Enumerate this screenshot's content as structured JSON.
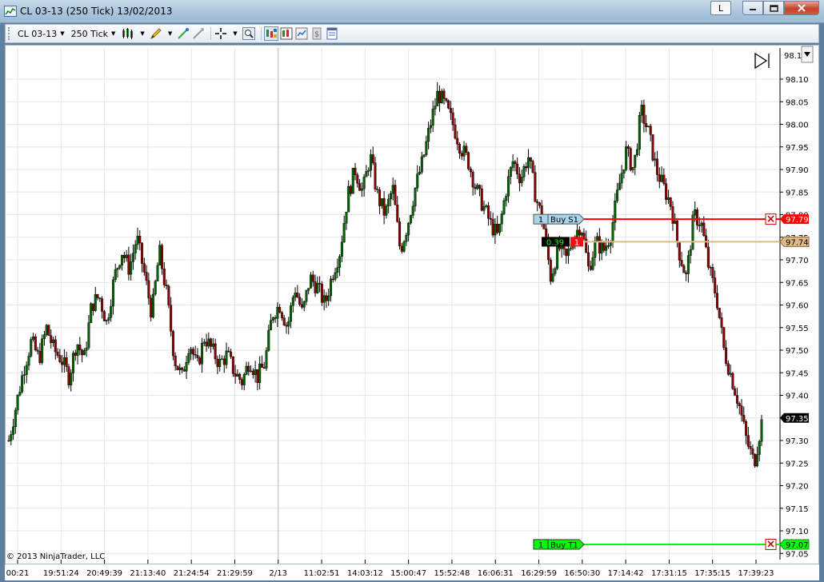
{
  "window": {
    "title": "CL 03-13 (250 Tick)  13/02/2013",
    "buttons": {
      "link_label": "L",
      "minimize": "minimize",
      "maximize": "maximize",
      "close": "close"
    }
  },
  "toolbar": {
    "instrument": "CL 03-13",
    "interval": "250 Tick",
    "icons": [
      "bar-type-icon",
      "drawing-pencil-icon",
      "draw-objects-icon",
      "drawing-remove-icon",
      "crosshair-icon",
      "zoom-icon",
      "chart-trader-icon",
      "data-box-icon",
      "strategies-icon",
      "dollar-icon",
      "properties-icon"
    ]
  },
  "chart": {
    "copyright": "© 2013 NinjaTrader, LLC",
    "y_ticks": [
      "98.10",
      "98.05",
      "98.00",
      "97.95",
      "97.90",
      "97.85",
      "97.80",
      "97.75",
      "97.70",
      "97.65",
      "97.60",
      "97.55",
      "97.50",
      "97.45",
      "97.40",
      "97.35",
      "97.30",
      "97.25",
      "97.20",
      "97.15",
      "97.10",
      "97.05"
    ],
    "y_top_partial": "98.1",
    "x_ticks": [
      "00:21",
      "19:51:24",
      "20:49:39",
      "21:13:40",
      "21:24:54",
      "21:29:59",
      "2/13",
      "11:02:51",
      "14:03:12",
      "15:00:47",
      "15:52:48",
      "16:06:31",
      "16:29:59",
      "16:50:30",
      "17:14:42",
      "17:31:15",
      "17:35:15",
      "17:39:23"
    ],
    "last_price": "97.35",
    "orders": {
      "stop": {
        "qty": "1",
        "label": "Buy S1",
        "price": "97.79",
        "color": "#ff0000"
      },
      "target": {
        "qty": "1",
        "label": "Buy T1",
        "price": "97.07",
        "color": "#00ff00"
      }
    },
    "position": {
      "pnl": "0.39",
      "qty": "1",
      "price": "97.74",
      "color": "#deb887"
    },
    "colors": {
      "up_candle": "#006400",
      "down_candle": "#8b0000",
      "grid": "#e6e6e6"
    }
  },
  "chart_data": {
    "type": "candlestick",
    "title": "CL 03-13 (250 Tick)",
    "ylim": [
      97.03,
      98.16
    ],
    "x": [
      "00:21",
      "19:51:24",
      "20:49:39",
      "21:13:40",
      "21:24:54",
      "21:29:59",
      "2/13",
      "11:02:51",
      "14:03:12",
      "15:00:47",
      "15:52:48",
      "16:06:31",
      "16:29:59",
      "16:50:30",
      "17:14:42",
      "17:31:15",
      "17:35:15",
      "17:39:23"
    ],
    "close_path": [
      97.3,
      97.38,
      97.46,
      97.52,
      97.48,
      97.55,
      97.5,
      97.48,
      97.44,
      97.52,
      97.48,
      97.6,
      97.62,
      97.56,
      97.66,
      97.72,
      97.68,
      97.75,
      97.67,
      97.58,
      97.72,
      97.62,
      97.48,
      97.44,
      97.52,
      97.46,
      97.53,
      97.5,
      97.47,
      97.49,
      97.45,
      97.43,
      97.48,
      97.44,
      97.47,
      97.58,
      97.6,
      97.55,
      97.64,
      97.58,
      97.66,
      97.64,
      97.6,
      97.67,
      97.72,
      97.84,
      97.9,
      97.85,
      97.93,
      97.84,
      97.8,
      97.86,
      97.72,
      97.78,
      97.86,
      97.92,
      98.0,
      98.07,
      98.04,
      98.0,
      97.95,
      97.92,
      97.86,
      97.82,
      97.78,
      97.75,
      97.85,
      97.92,
      97.88,
      97.93,
      97.84,
      97.78,
      97.66,
      97.73,
      97.7,
      97.75,
      97.78,
      97.68,
      97.74,
      97.72,
      97.76,
      97.86,
      97.94,
      97.9,
      98.03,
      97.98,
      97.9,
      97.86,
      97.82,
      97.72,
      97.66,
      97.8,
      97.78,
      97.68,
      97.62,
      97.5,
      97.44,
      97.38,
      97.3,
      97.25,
      97.34
    ]
  }
}
